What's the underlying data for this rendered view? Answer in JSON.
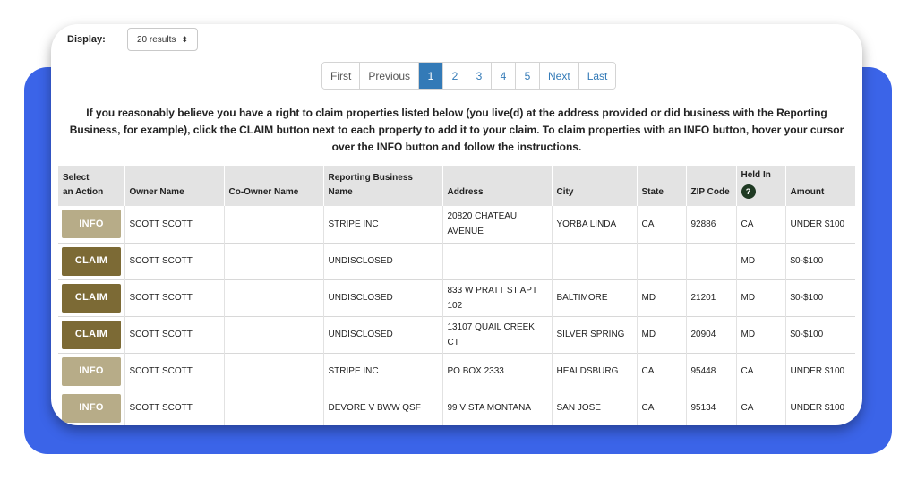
{
  "display": {
    "label": "Display:",
    "selected": "20 results"
  },
  "pagination": {
    "items": [
      {
        "label": "First",
        "active": false
      },
      {
        "label": "Previous",
        "active": false
      },
      {
        "label": "1",
        "active": true
      },
      {
        "label": "2",
        "active": false
      },
      {
        "label": "3",
        "active": false
      },
      {
        "label": "4",
        "active": false
      },
      {
        "label": "5",
        "active": false
      },
      {
        "label": "Next",
        "active": false
      },
      {
        "label": "Last",
        "active": false
      }
    ]
  },
  "instructions": "If you reasonably believe you have a right to claim properties listed below (you live(d) at the address provided or did business with the Reporting Business, for example), click the CLAIM button next to each property to add it to your claim. To claim properties with an INFO button, hover your cursor over the INFO button and follow the instructions.",
  "table": {
    "headers": {
      "select_line1": "Select",
      "select_line2": "an Action",
      "owner": "Owner Name",
      "co_owner": "Co-Owner Name",
      "business_line1": "Reporting Business",
      "business_line2": "Name",
      "address": "Address",
      "city": "City",
      "state": "State",
      "zip": "ZIP Code",
      "held_in": "Held In",
      "held_in_badge": "?",
      "amount": "Amount"
    },
    "rows": [
      {
        "action": "INFO",
        "owner": "SCOTT SCOTT",
        "co_owner": "",
        "business": "STRIPE INC",
        "address": "20820 CHATEAU AVENUE",
        "city": "YORBA LINDA",
        "state": "CA",
        "zip": "92886",
        "held_in": "CA",
        "amount": "UNDER $100"
      },
      {
        "action": "CLAIM",
        "owner": "SCOTT SCOTT",
        "co_owner": "",
        "business": "UNDISCLOSED",
        "address": "",
        "city": "",
        "state": "",
        "zip": "",
        "held_in": "MD",
        "amount": "$0-$100"
      },
      {
        "action": "CLAIM",
        "owner": "SCOTT SCOTT",
        "co_owner": "",
        "business": "UNDISCLOSED",
        "address": "833 W PRATT ST APT 102",
        "city": "BALTIMORE",
        "state": "MD",
        "zip": "21201",
        "held_in": "MD",
        "amount": "$0-$100"
      },
      {
        "action": "CLAIM",
        "owner": "SCOTT SCOTT",
        "co_owner": "",
        "business": "UNDISCLOSED",
        "address": "13107 QUAIL CREEK CT",
        "city": "SILVER SPRING",
        "state": "MD",
        "zip": "20904",
        "held_in": "MD",
        "amount": "$0-$100"
      },
      {
        "action": "INFO",
        "owner": "SCOTT SCOTT",
        "co_owner": "",
        "business": "STRIPE INC",
        "address": "PO BOX 2333",
        "city": "HEALDSBURG",
        "state": "CA",
        "zip": "95448",
        "held_in": "CA",
        "amount": "UNDER $100"
      },
      {
        "action": "INFO",
        "owner": "SCOTT SCOTT",
        "co_owner": "",
        "business": "DEVORE V BWW QSF",
        "address": "99 VISTA MONTANA",
        "city": "SAN JOSE",
        "state": "CA",
        "zip": "95134",
        "held_in": "CA",
        "amount": "UNDER $100"
      }
    ]
  },
  "colors": {
    "backdrop": "#3b64e8",
    "info_button": "#b7ac88",
    "claim_button": "#7c6a35",
    "active_page": "#337ab7"
  }
}
